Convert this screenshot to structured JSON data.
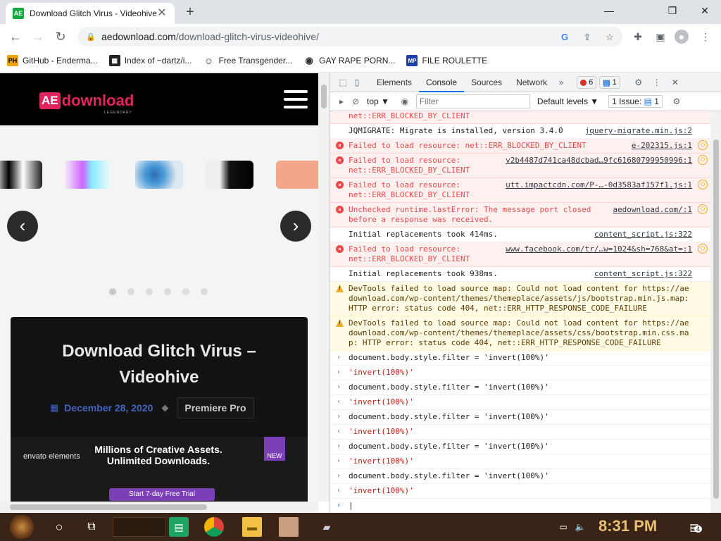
{
  "browser": {
    "tab": {
      "favicon": "AE",
      "title": "Download Glitch Virus - Videohive",
      "close": "✕"
    },
    "new_tab": "+",
    "window": {
      "minimize": "—",
      "restore": "❐",
      "close": "✕"
    },
    "url_host": "aedownload.com",
    "url_path": "/download-glitch-virus-videohive/",
    "bookmarks": [
      {
        "icon": "PH",
        "label": "GitHub - Enderma..."
      },
      {
        "icon": "▦",
        "label": "Index of ~dartz/i..."
      },
      {
        "icon": "☺",
        "label": "Free Transgender..."
      },
      {
        "icon": "◉",
        "label": "GAY RAPE PORN..."
      },
      {
        "icon": "MP",
        "label": "FILE ROULETTE"
      }
    ]
  },
  "site": {
    "logo_mark": "AE",
    "logo_word": "download",
    "logo_tag": "LEGENDARY",
    "post_title": "Download Glitch Virus – Videohive",
    "post_date": "December 28, 2020",
    "post_category": "Premiere Pro",
    "banner": {
      "brand": "envato elements",
      "headline": "Millions of Creative Assets. Unlimited Downloads.",
      "new": "NEW",
      "cta": "Start 7-day Free Trial"
    },
    "carousel_prev": "‹",
    "carousel_next": "›"
  },
  "devtools": {
    "tabs": [
      "Elements",
      "Console",
      "Sources",
      "Network"
    ],
    "more": "»",
    "errors_count": "6",
    "messages_count": "1",
    "context": "top ▼",
    "filter_placeholder": "Filter",
    "levels": "Default levels ▼",
    "issues_label": "1 Issue:",
    "issues_count": "1",
    "log": [
      {
        "type": "error-tail",
        "msg": "net::ERR_BLOCKED_BY_CLIENT",
        "src": ""
      },
      {
        "type": "info",
        "msg": "JQMIGRATE: Migrate is installed, version 3.4.0",
        "src": "jquery-migrate.min.js:2"
      },
      {
        "type": "error",
        "msg": "Failed to load resource: net::ERR_BLOCKED_BY_CLIENT",
        "src": "e-202315.js:1"
      },
      {
        "type": "error",
        "msg": "Failed to load resource:\nnet::ERR_BLOCKED_BY_CLIENT",
        "src": "v2b4487d741ca48dcbad…9fc61680799950996:1"
      },
      {
        "type": "error",
        "msg": "Failed to load resource:\nnet::ERR_BLOCKED_BY_CLIENT",
        "src": "utt.impactcdn.com/P-…-0d3583af157f1.js:1"
      },
      {
        "type": "error",
        "msg": "Unchecked runtime.lastError: The message port closed\nbefore a response was received.",
        "src": "aedownload.com/:1"
      },
      {
        "type": "info",
        "msg": "Initial replacements took 414ms.",
        "src": "content_script.js:322"
      },
      {
        "type": "error",
        "msg": "Failed to load resource:\nnet::ERR_BLOCKED_BY_CLIENT",
        "src": "www.facebook.com/tr/…w=1024&sh=768&at=:1"
      },
      {
        "type": "info",
        "msg": "Initial replacements took 938ms.",
        "src": "content_script.js:322"
      },
      {
        "type": "warn",
        "msg": "DevTools failed to load source map: Could not load content for https://aedownload.com/wp-content/themes/themeplace/assets/js/bootstrap.min.js.map: HTTP error: status code 404, net::ERR_HTTP_RESPONSE_CODE_FAILURE",
        "src": ""
      },
      {
        "type": "warn",
        "msg": "DevTools failed to load source map: Could not load content for https://aedownload.com/wp-content/themes/themeplace/assets/css/bootstrap.min.css.map: HTTP error: status code 404, net::ERR_HTTP_RESPONSE_CODE_FAILURE",
        "src": ""
      },
      {
        "type": "input",
        "msg": "document.body.style.filter = 'invert(100%)'",
        "src": ""
      },
      {
        "type": "output",
        "msg": "'invert(100%)'",
        "src": ""
      },
      {
        "type": "input",
        "msg": "document.body.style.filter = 'invert(100%)'",
        "src": ""
      },
      {
        "type": "output",
        "msg": "'invert(100%)'",
        "src": ""
      },
      {
        "type": "input",
        "msg": "document.body.style.filter = 'invert(100%)'",
        "src": ""
      },
      {
        "type": "output",
        "msg": "'invert(100%)'",
        "src": ""
      },
      {
        "type": "input",
        "msg": "document.body.style.filter = 'invert(100%)'",
        "src": ""
      },
      {
        "type": "output",
        "msg": "'invert(100%)'",
        "src": ""
      },
      {
        "type": "input",
        "msg": "document.body.style.filter = 'invert(100%)'",
        "src": ""
      },
      {
        "type": "output",
        "msg": "'invert(100%)'",
        "src": ""
      }
    ]
  },
  "taskbar": {
    "clock": "8:31 PM",
    "notification_count": "4"
  },
  "colors": {
    "accent": "#1a73e8",
    "error": "#e8484a",
    "warning": "#f2ab26",
    "site_brand": "#e0245e"
  }
}
